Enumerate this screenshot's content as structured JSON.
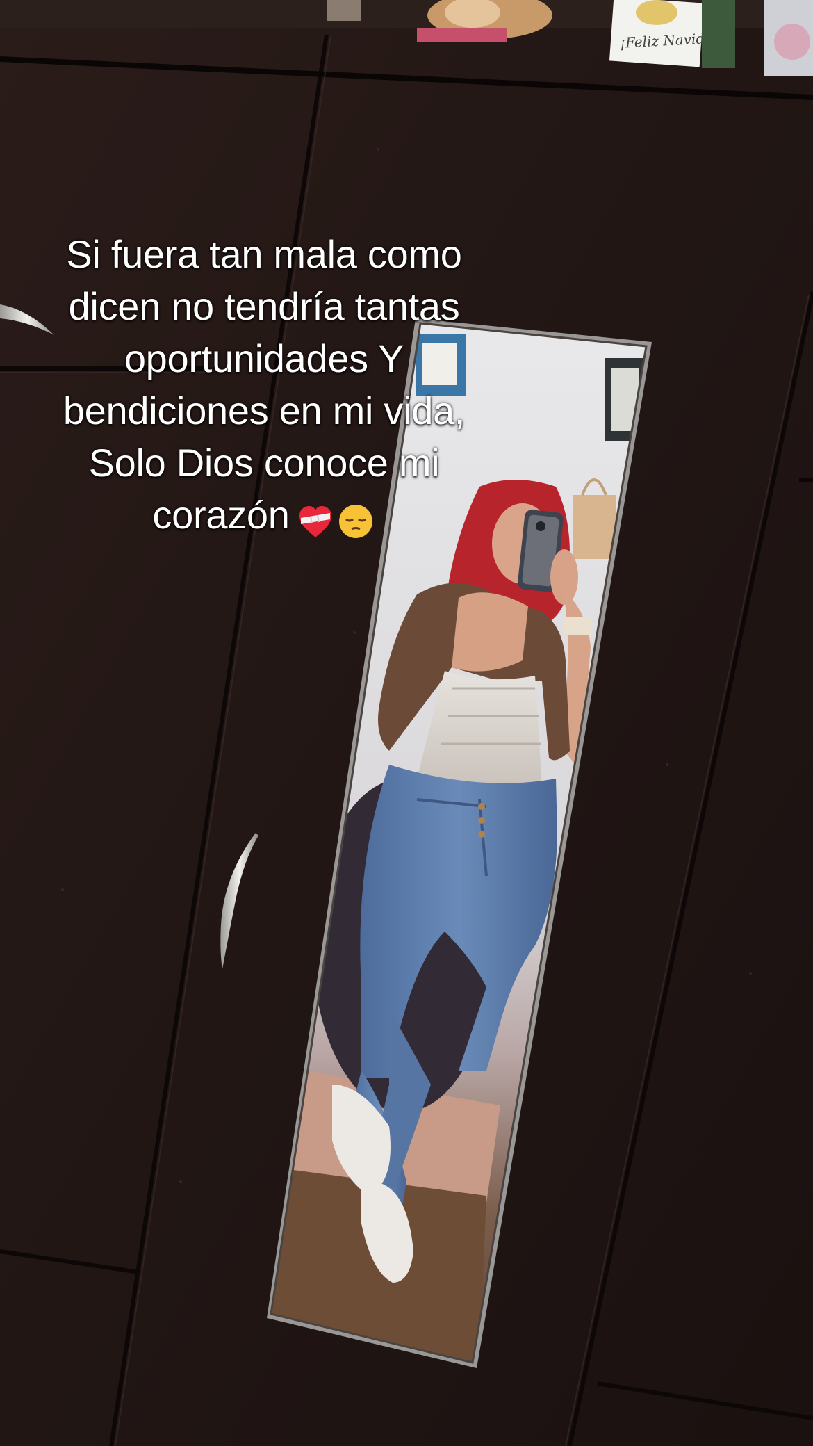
{
  "photo": {
    "caption_lines": [
      "Si fuera tan mala como",
      "dicen no tendría tantas",
      "oportunidades Y",
      "bendiciones en mi vida,",
      "Solo Dios conoce mi",
      "corazón"
    ],
    "caption_emojis": [
      "mending-heart-emoji",
      "pensive-face-emoji"
    ],
    "background_sign_text": "¡Feliz Navidad!",
    "colors": {
      "wardrobe": "#231715",
      "caption_text": "#ffffff",
      "jeans": "#5a7aa8",
      "hair": "#b8242b",
      "jacket": "#6b4a38"
    }
  }
}
